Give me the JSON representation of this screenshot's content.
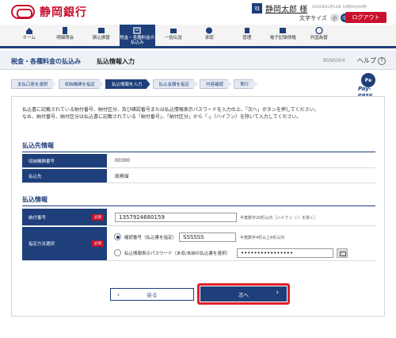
{
  "brand": {
    "name": "静岡銀行"
  },
  "user": {
    "badge": "ﾏｽ",
    "name": "静岡太郎 様",
    "login_info": "20XX年02月13日 10時00分00秒"
  },
  "font_size": {
    "label": "文字サイズ",
    "options": [
      "小",
      "中",
      "大"
    ],
    "selected": "中"
  },
  "logout_label": "ログアウト",
  "nav": [
    {
      "label": "ホーム",
      "icon": "home-icon"
    },
    {
      "label": "明細照会",
      "icon": "document-icon"
    },
    {
      "label": "振込振替",
      "icon": "transfer-icon"
    },
    {
      "label": "税金・各種料金の払込み",
      "icon": "tax-payment-icon",
      "active": true
    },
    {
      "label": "一括伝送",
      "icon": "batch-send-icon"
    },
    {
      "label": "承認",
      "icon": "approve-icon"
    },
    {
      "label": "管理",
      "icon": "settings-icon"
    },
    {
      "label": "電子記録債権",
      "icon": "e-bond-icon"
    },
    {
      "label": "外国為替",
      "icon": "globe-icon"
    }
  ],
  "page": {
    "category": "税金・各種料金の払込み",
    "title": "払込情報入力",
    "code": "BSNS004",
    "help": "ヘルプ"
  },
  "steps": [
    {
      "label": "支払口座を選択"
    },
    {
      "label": "収納機関を指定"
    },
    {
      "label": "払込情報を入力",
      "active": true
    },
    {
      "label": "払込金額を指定"
    },
    {
      "label": "内容確認"
    },
    {
      "label": "実行"
    }
  ],
  "payeasy": {
    "mark": "Pe",
    "text": "Pay-easy"
  },
  "description": [
    "払込書に記載されている納付番号、納付区分、及び確認番号または払込情報表示パスワードを入力の上、「次へ」ボタンを押してください。",
    "なお、納付番号、納付区分は払込書に記載されている「納付番号」、「納付区分」から「-」（ハイフン）を除いて入力してください。"
  ],
  "payee_section": {
    "title": "払込先情報",
    "rows": [
      {
        "label": "収納機関番号",
        "value": "00300"
      },
      {
        "label": "払込先",
        "value": "総務省"
      }
    ]
  },
  "payment_section": {
    "title": "払込情報",
    "number_label": "納付番号",
    "required": "必須",
    "number_value": "1357924680159",
    "number_hint": "半角数字20桁以内［ハイフン（-）を除く］",
    "method_label": "指定方法選択",
    "option1_label": "確認番号（払込書を指定）",
    "option1_value": "SSSSSS",
    "option1_hint": "半角数字4桁以上6桁以内",
    "option2_label": "払込情報表示パスワード（未収/未納の払込書を選択）",
    "option2_value": "••••••••••••••••"
  },
  "buttons": {
    "back": "戻る",
    "next": "次へ"
  },
  "colors": {
    "brand_red": "#c8102e",
    "navy": "#1e3f7a",
    "highlight": "#e0202a"
  }
}
